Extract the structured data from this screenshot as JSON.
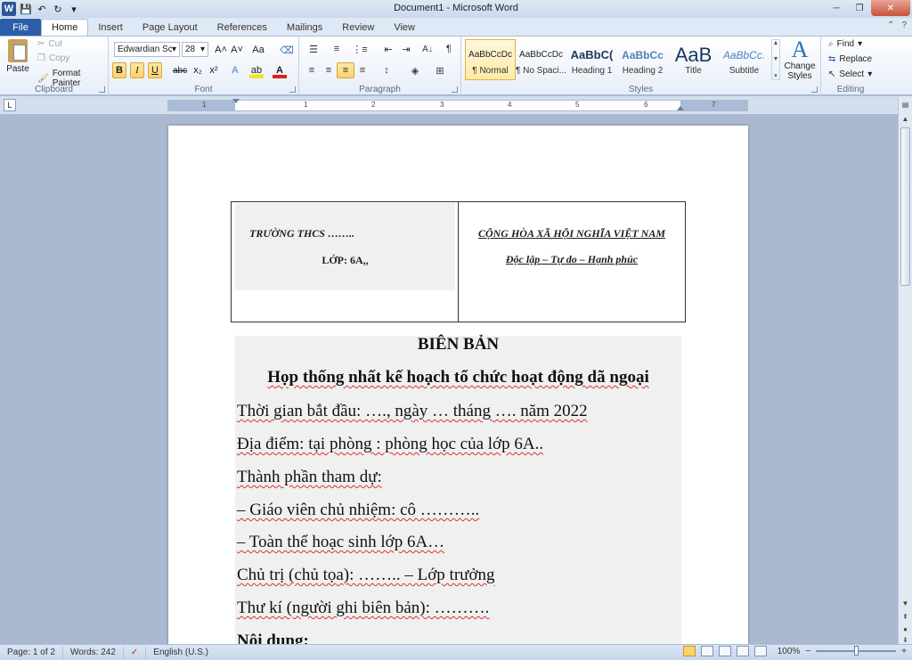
{
  "window": {
    "title": "Document1 - Microsoft Word",
    "minimize_glyph": "─",
    "restore_glyph": "❐",
    "close_glyph": "✕"
  },
  "qat": {
    "app_icon": "W",
    "save_glyph": "💾",
    "undo_glyph": "↶",
    "redo_glyph": "↻",
    "customize_glyph": "▾"
  },
  "tabs": {
    "file": "File",
    "items": [
      "Home",
      "Insert",
      "Page Layout",
      "References",
      "Mailings",
      "Review",
      "View"
    ],
    "active": "Home",
    "minimize_ribbon_glyph": "⌃",
    "help_glyph": "?"
  },
  "ribbon": {
    "clipboard": {
      "label": "Clipboard",
      "paste": "Paste",
      "cut": "Cut",
      "copy": "Copy",
      "format_painter": "Format Painter"
    },
    "font": {
      "label": "Font",
      "font_name": "Edwardian Scrip",
      "font_size": "28",
      "grow": "A˄",
      "shrink": "A˅",
      "change_case": "Aa",
      "bold": "B",
      "italic": "I",
      "underline": "U",
      "strike": "abc",
      "subscript": "x₂",
      "superscript": "x²",
      "text_effects": "A",
      "highlight": "ab",
      "font_color": "A"
    },
    "paragraph": {
      "label": "Paragraph",
      "bullets": "☰",
      "numbering": "≡",
      "multilevel": "⋮≡",
      "decrease_indent": "⇤",
      "increase_indent": "⇥",
      "sort": "A↓",
      "show_marks": "¶",
      "align_left": "≡",
      "center": "≡",
      "align_right": "≡",
      "justify": "≡",
      "line_spacing": "↕",
      "shading": "◈",
      "borders": "⊞"
    },
    "styles": {
      "label": "Styles",
      "items": [
        {
          "preview": "AaBbCcDc",
          "name": "¶ Normal"
        },
        {
          "preview": "AaBbCcDc",
          "name": "¶ No Spaci..."
        },
        {
          "preview": "AaBbC(",
          "name": "Heading 1"
        },
        {
          "preview": "AaBbCc",
          "name": "Heading 2"
        },
        {
          "preview": "AaB",
          "name": "Title"
        },
        {
          "preview": "AaBbCc.",
          "name": "Subtitle"
        }
      ],
      "change_styles": "Change Styles",
      "change_styles_icon": "A"
    },
    "editing": {
      "label": "Editing",
      "find": "Find",
      "replace": "Replace",
      "select": "Select"
    }
  },
  "ruler": {
    "tab_selector": "L",
    "numbers": [
      "1",
      "1",
      "2",
      "3",
      "4",
      "5",
      "6",
      "7"
    ]
  },
  "document": {
    "school": "TRƯỜNG THCS ……..",
    "class": "LỚP: 6A,,",
    "nation": "CỘNG HÒA XÃ HỘI NGHĨA VIỆT NAM",
    "motto": "Độc lập – Tự do – Hạnh phúc",
    "title": "BIÊN BẢN",
    "subtitle": "Họp thống nhất kế hoạch tổ chức hoạt động dã ngoại",
    "lines": [
      "Thời gian bắt đầu: …., ngày … tháng …. năm 2022",
      "Địa điểm: tại phòng : phòng học của lớp 6A..",
      "Thành phần tham dự:",
      "– Giáo viên chủ nhiệm: cô ………..",
      "– Toàn thể hoạc sinh lớp 6A…",
      "Chủ trị (chủ tọa): …….. – Lớp trưởng",
      "Thư kí (người ghi biên bản): ………."
    ],
    "cut_line": "Nội dung:"
  },
  "statusbar": {
    "page": "Page: 1 of 2",
    "words": "Words: 242",
    "proofing_glyph": "✓",
    "language": "English (U.S.)",
    "zoom": "100%",
    "zoom_out": "−",
    "zoom_in": "+"
  }
}
